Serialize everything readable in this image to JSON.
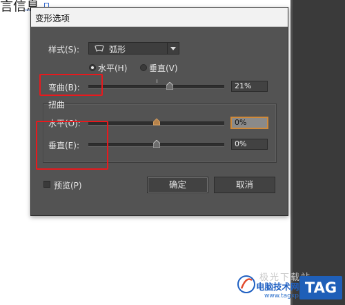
{
  "background": {
    "text": "言信息"
  },
  "dialog": {
    "title": "变形选项",
    "style_label": "样式(S):",
    "style_value": "弧形",
    "orientation": {
      "horizontal": "水平(H)",
      "vertical": "垂直(V)",
      "selected": "horizontal"
    },
    "bend": {
      "label": "弯曲(B):",
      "value": "21%",
      "slider_fraction": 0.6
    },
    "distortion": {
      "group_label": "扭曲",
      "horizontal": {
        "label": "水平(O):",
        "value": "0%",
        "slider_fraction": 0.5
      },
      "vertical": {
        "label": "垂直(E):",
        "value": "0%",
        "slider_fraction": 0.5
      }
    },
    "preview": {
      "label": "预览(P)",
      "checked": false
    },
    "ok_label": "确定",
    "cancel_label": "取消"
  },
  "watermark": {
    "top": "极光下载站",
    "text": "电脑技术网",
    "url": "www.tagxp.com",
    "tag": "TAG"
  },
  "colors": {
    "dialog_bg": "#535353",
    "highlight": "#e8191d",
    "accent": "#d08a3a"
  }
}
